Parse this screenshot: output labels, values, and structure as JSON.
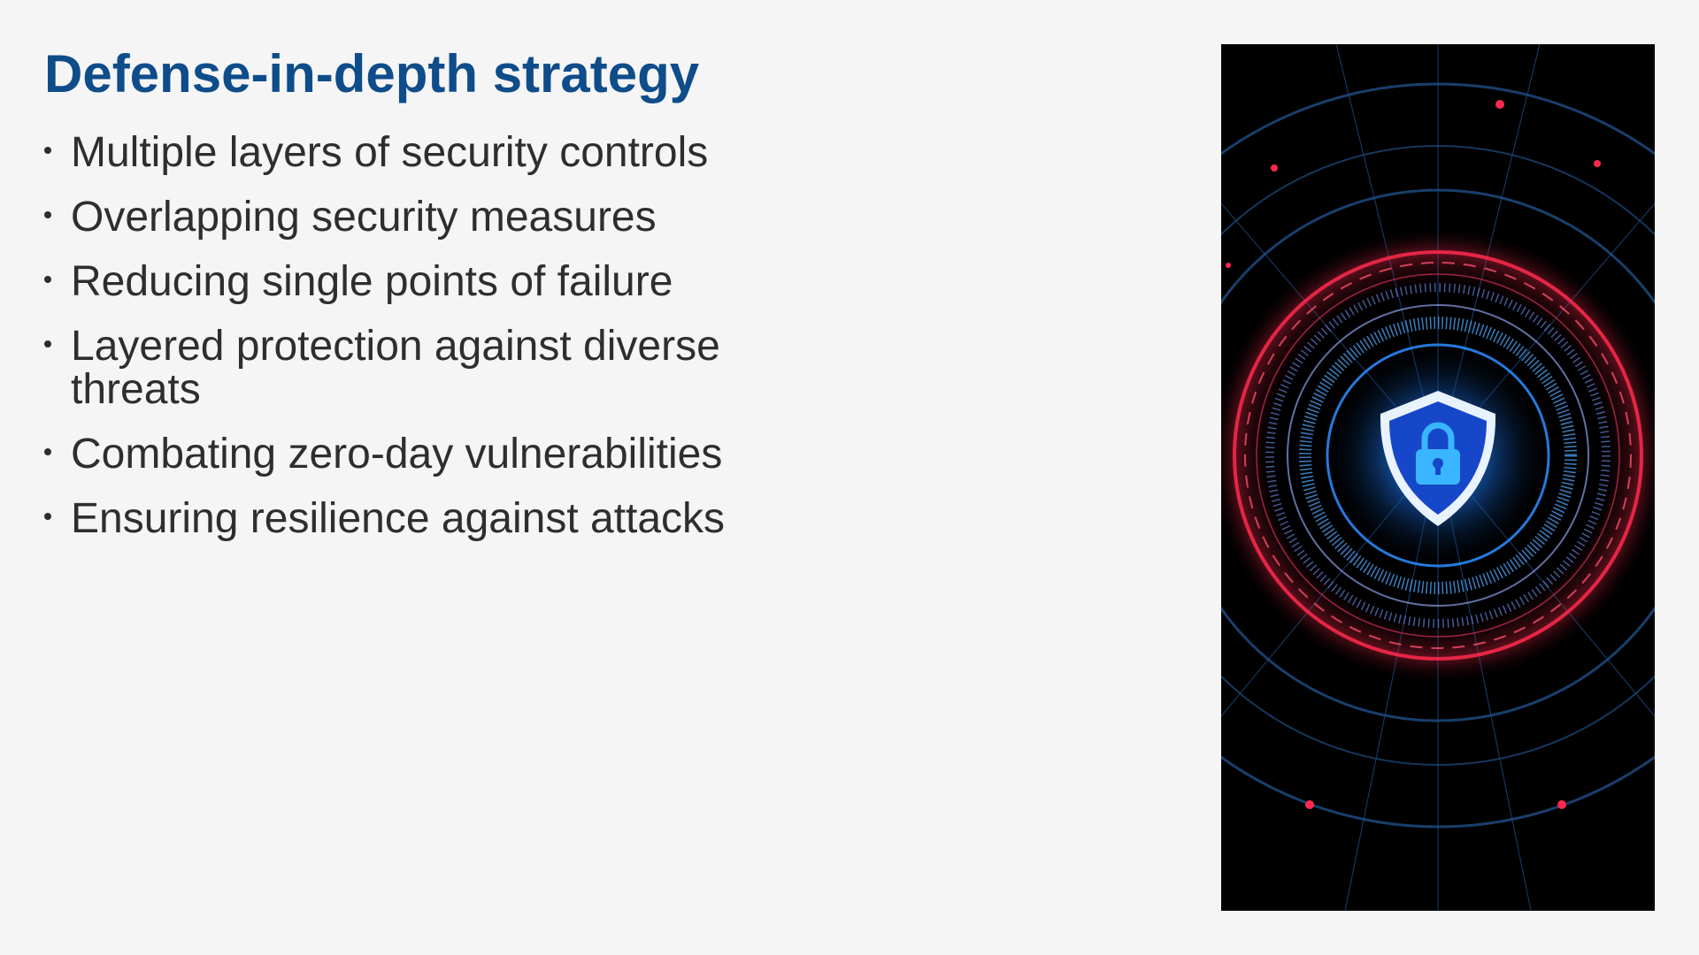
{
  "slide": {
    "title": "Defense-in-depth strategy",
    "bullets": [
      "Multiple layers of security controls",
      "Overlapping security measures",
      "Reducing single points of failure",
      "Layered protection against diverse threats",
      "Combating zero-day vulnerabilities",
      "Ensuring resilience against attacks"
    ]
  },
  "image": {
    "icon": "shield-lock-icon",
    "colors": {
      "background": "#000000",
      "ring_red": "#ff2a4d",
      "ring_blue": "#2a8cff",
      "shield": "#1747c9",
      "title": "#0f4c8a"
    }
  }
}
